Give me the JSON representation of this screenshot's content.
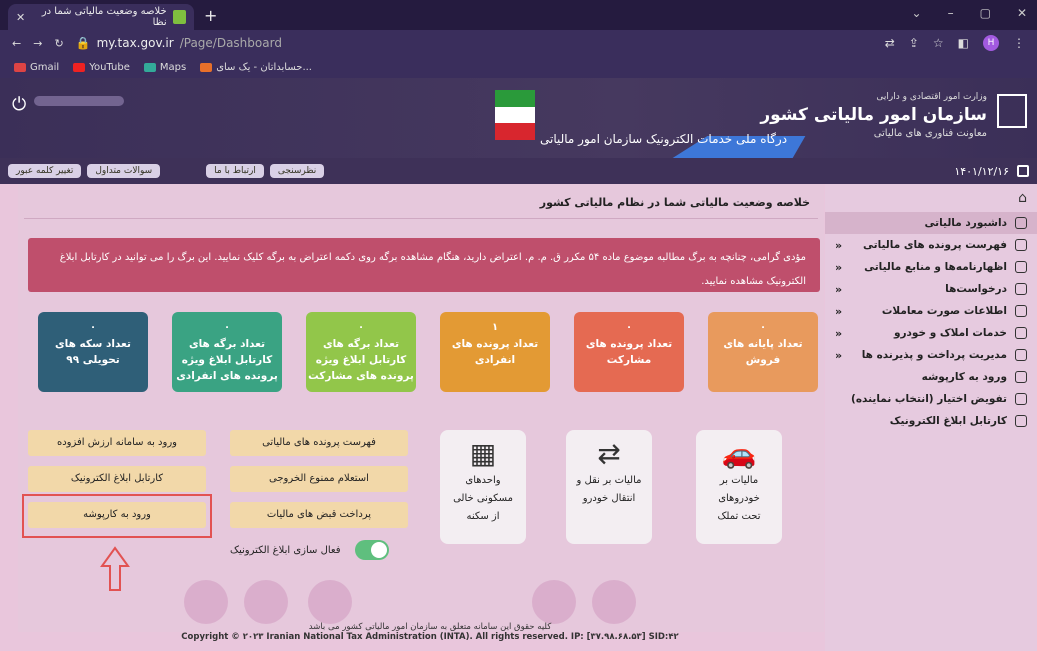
{
  "browser": {
    "tab_title": "خلاصه وضعیت مالیاتی شما در نظا",
    "url_host": "my.tax.gov.ir",
    "url_path": "/Page/Dashboard",
    "bookmarks": [
      "Gmail",
      "YouTube",
      "Maps",
      "حسابداتان - یک سای..."
    ],
    "profile_initial": "H"
  },
  "header": {
    "portal_title": "درگاه ملی خدمات الکترونیک سازمان امور مالیاتی",
    "ministry": "وزارت امور اقتصادی و دارایی",
    "org_name": "سازمان امور مالیاتی کشور",
    "deputy": "معاونت فناوری های مالیاتی"
  },
  "toolbar": {
    "buttons": [
      "تغییر کلمه عبور",
      "سوالات متداول",
      "ارتباط با ما",
      "نظرسنجی"
    ],
    "date": "۱۴۰۱/۱۲/۱۶"
  },
  "sidebar": {
    "items": [
      {
        "label": "داشبورد مالیاتی",
        "chevron": ""
      },
      {
        "label": "فهرست پرونده های مالیاتی",
        "chevron": "«"
      },
      {
        "label": "اظهارنامه‌ها و منابع مالیاتی",
        "chevron": "«"
      },
      {
        "label": "درخواست‌ها",
        "chevron": "«"
      },
      {
        "label": "اطلاعات صورت معاملات",
        "chevron": "«"
      },
      {
        "label": "خدمات املاک و خودرو",
        "chevron": "«"
      },
      {
        "label": "مدیریت پرداخت و پذیرنده ها",
        "chevron": "«"
      },
      {
        "label": "ورود به کارپوشه",
        "chevron": ""
      },
      {
        "label": "تفویض اختیار (انتخاب نماینده)",
        "chevron": ""
      },
      {
        "label": "کارتابل ابلاغ الکترونیک",
        "chevron": ""
      }
    ]
  },
  "main": {
    "title": "خلاصه وضعیت مالیاتی شما در نظام مالیاتی کشور",
    "alert_line1": "مؤدی گرامی، چنانچه به برگ مطالبه موضوع ماده ۵۴ مکرر ق. م. م. اعتراض دارید، هنگام مشاهده برگه روی دکمه اعتراض به برگه کلیک نمایید. این برگ را می توانید در کارتابل ابلاغ",
    "alert_line2": "الکترونیک مشاهده نمایید.",
    "cards": [
      {
        "num": "۰",
        "label": "تعداد پایانه های فروش",
        "color": "#e89a5d"
      },
      {
        "num": "۰",
        "label": "تعداد پرونده های مشارکت",
        "color": "#e56a52"
      },
      {
        "num": "۱",
        "label": "تعداد پرونده های انفرادی",
        "color": "#e39a34"
      },
      {
        "num": "۰",
        "label": "تعداد برگه های کارتابل ابلاغ ویژه پرونده های مشارکت",
        "color": "#92c64a"
      },
      {
        "num": "۰",
        "label": "تعداد برگه های کارتابل ابلاغ ویژه پرونده های انفرادی",
        "color": "#3aa383"
      },
      {
        "num": "۰",
        "label": "تعداد سکه های تحویلی ۹۹",
        "color": "#2f5f78"
      }
    ],
    "services": [
      {
        "label1": "مالیات بر",
        "label2": "خودروهای",
        "label3": "تحت تملک"
      },
      {
        "label1": "مالیات بر نقل و",
        "label2": "انتقال خودرو",
        "label3": ""
      },
      {
        "label1": "واحدهای",
        "label2": "مسکونی خالی",
        "label3": "از سکنه"
      }
    ],
    "buttons_middle": [
      "فهرست پرونده های مالیاتی",
      "استعلام ممنوع الخروجی",
      "پرداخت قبض های مالیات"
    ],
    "buttons_left": [
      "ورود به سامانه ارزش افزوده",
      "کارتابل ابلاغ الکترونیک",
      "ورود به کارپوشه"
    ],
    "toggle_label": "فعال سازی ابلاغ الکترونیک"
  },
  "footer": {
    "fa": "کلیه حقوق این سامانه متعلق به سازمان امور مالیاتی کشور می باشد",
    "en": "Copyright © ۲۰۲۳ Iranian National Tax Administration (INTA). All rights reserved. IP: [۳۷.۹۸.۶۸.۵۳] SID:۴۲"
  }
}
